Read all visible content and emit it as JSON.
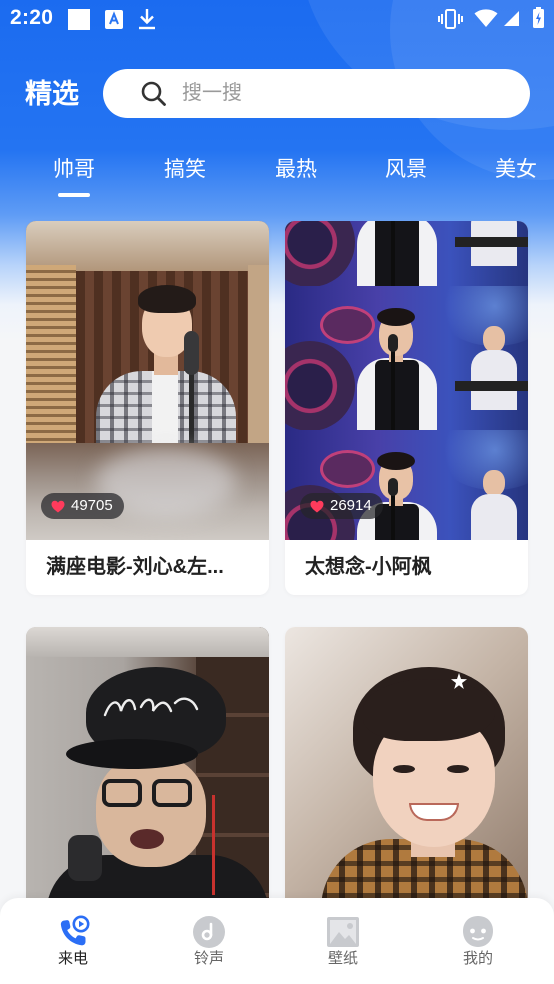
{
  "status_bar": {
    "time": "2:20",
    "left_icons": [
      "notification-square-icon",
      "app-a-icon",
      "download-icon"
    ],
    "right_icons": [
      "vibrate-icon",
      "wifi-icon",
      "signal-icon",
      "battery-charging-icon"
    ]
  },
  "header": {
    "title": "精选",
    "search_placeholder": "搜一搜",
    "search_icon": "search-icon"
  },
  "tabs": [
    {
      "label": "帅哥",
      "active": true
    },
    {
      "label": "搞笑"
    },
    {
      "label": "最热"
    },
    {
      "label": "风景"
    },
    {
      "label": "美女"
    }
  ],
  "cards": [
    {
      "likes": "49705",
      "title": "满座电影-刘心&左..."
    },
    {
      "likes": "26914",
      "title": "太想念-小阿枫"
    },
    {},
    {}
  ],
  "like_icon": "heart-icon",
  "bottom_nav": [
    {
      "label": "来电",
      "icon": "phone-call-icon",
      "active": true
    },
    {
      "label": "铃声",
      "icon": "music-disc-icon"
    },
    {
      "label": "壁纸",
      "icon": "wallpaper-image-icon"
    },
    {
      "label": "我的",
      "icon": "profile-face-icon"
    }
  ],
  "colors": {
    "header_blue": "#1b6bf0",
    "accent": "#2b6ef5",
    "heart": "#ff3b5c",
    "nav_inactive": "#c8cace",
    "page_bg": "#f5f6f8"
  }
}
